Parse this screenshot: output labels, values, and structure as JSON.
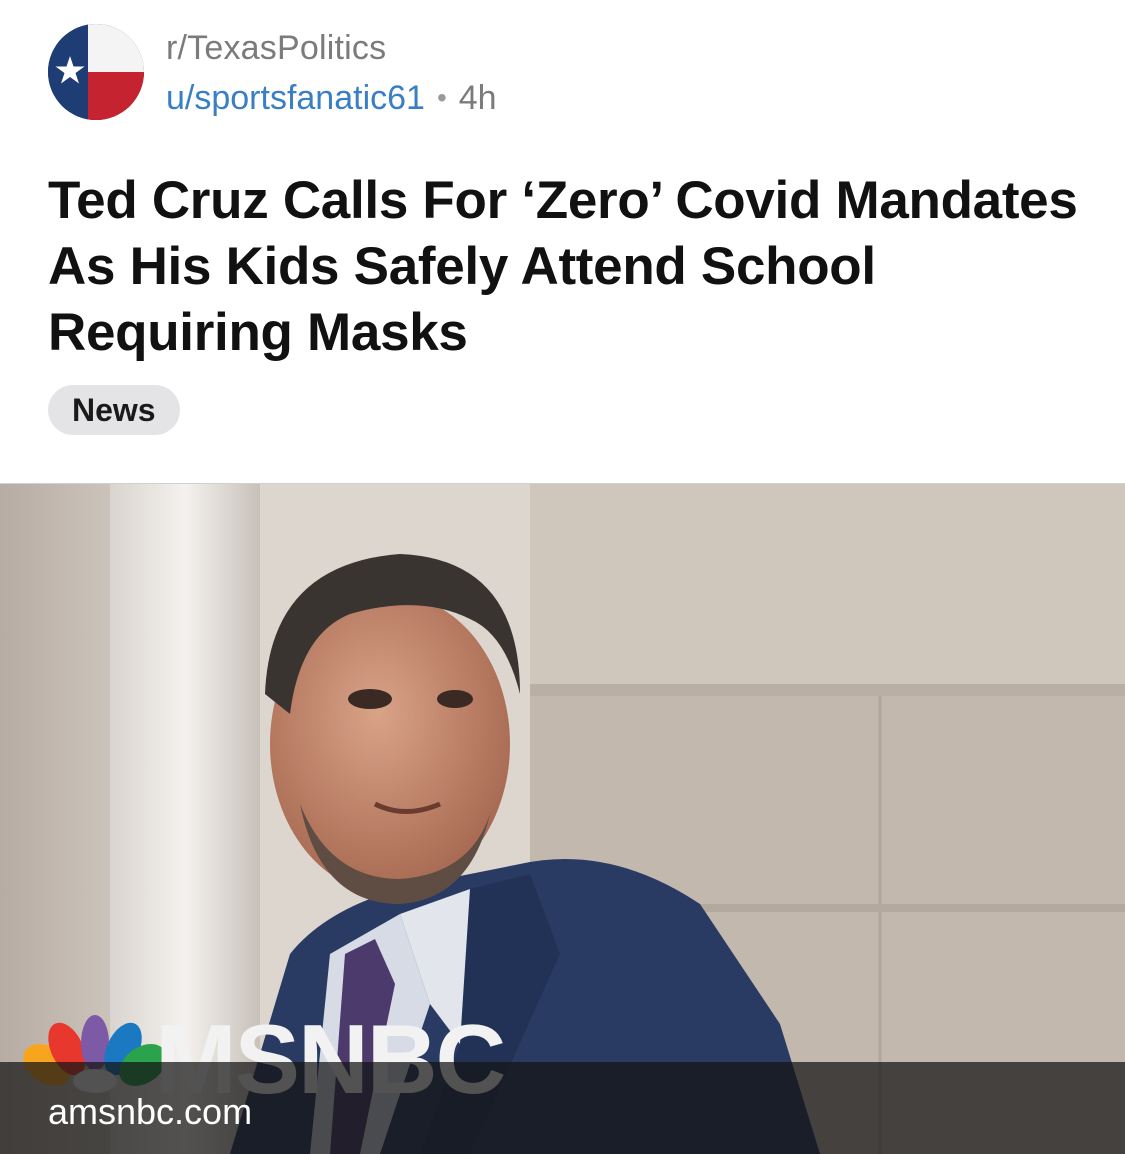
{
  "post": {
    "subreddit": "r/TexasPolitics",
    "author": "u/sportsfanatic61",
    "separator": "•",
    "age": "4h",
    "title": "Ted Cruz Calls For ‘Zero’ Covid Mandates As His Kids Safely Attend School Requiring Masks",
    "flair": "News"
  },
  "link_preview": {
    "brand_overlay": "MSNBC",
    "domain": "amsnbc.com"
  },
  "colors": {
    "author_link": "#3a7fc4",
    "muted_text": "#7b7b7b",
    "flair_bg": "#e4e4e7"
  },
  "icons": {
    "subreddit_avatar": "texas-flag-icon",
    "brand_logo": "peacock-logo-icon"
  }
}
